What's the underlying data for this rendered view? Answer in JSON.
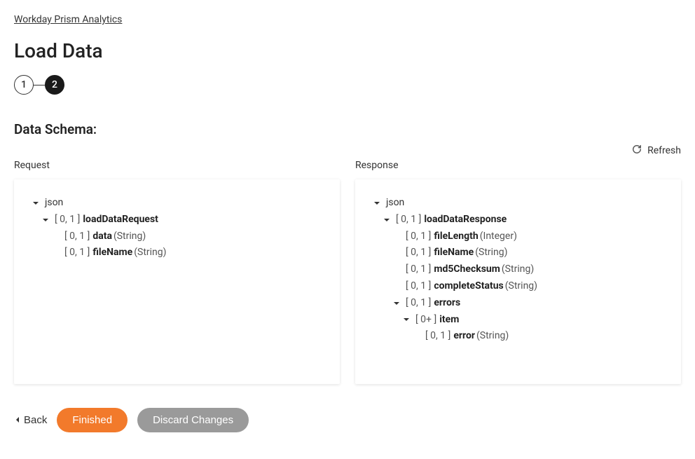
{
  "breadcrumb": "Workday Prism Analytics",
  "page_title": "Load Data",
  "stepper": {
    "step1": "1",
    "step2": "2"
  },
  "section_title": "Data Schema:",
  "refresh_label": "Refresh",
  "request_label": "Request",
  "response_label": "Response",
  "request_tree": {
    "root": "json",
    "node1_card": "[ 0, 1 ]",
    "node1_name": "loadDataRequest",
    "data_card": "[ 0, 1 ]",
    "data_name": "data",
    "data_type": "(String)",
    "fileName_card": "[ 0, 1 ]",
    "fileName_name": "fileName",
    "fileName_type": "(String)"
  },
  "response_tree": {
    "root": "json",
    "node1_card": "[ 0, 1 ]",
    "node1_name": "loadDataResponse",
    "fileLength_card": "[ 0, 1 ]",
    "fileLength_name": "fileLength",
    "fileLength_type": "(Integer)",
    "fileName_card": "[ 0, 1 ]",
    "fileName_name": "fileName",
    "fileName_type": "(String)",
    "md5_card": "[ 0, 1 ]",
    "md5_name": "md5Checksum",
    "md5_type": "(String)",
    "status_card": "[ 0, 1 ]",
    "status_name": "completeStatus",
    "status_type": "(String)",
    "errors_card": "[ 0, 1 ]",
    "errors_name": "errors",
    "item_card": "[ 0+ ]",
    "item_name": "item",
    "error_card": "[ 0, 1 ]",
    "error_name": "error",
    "error_type": "(String)"
  },
  "footer": {
    "back": "Back",
    "finished": "Finished",
    "discard": "Discard Changes"
  }
}
